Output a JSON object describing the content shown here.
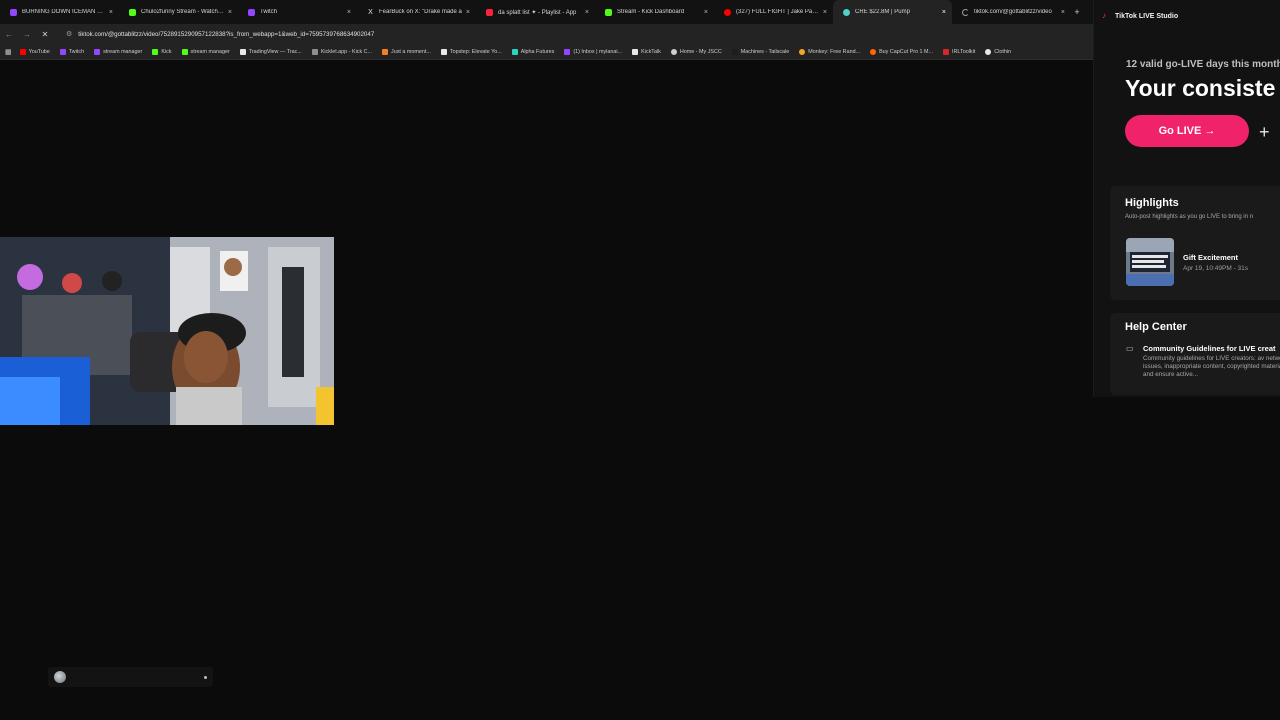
{
  "browser": {
    "tabs": [
      {
        "title": "BURNING DOWN ICEMAN FIN",
        "favicon_color": "#9147ff"
      },
      {
        "title": "Chulo2funny Stream - Watch Li",
        "favicon_color": "#53fc18"
      },
      {
        "title": "Twitch",
        "favicon_color": "#9147ff"
      },
      {
        "title": "FearBuck on X: \"Drake made a",
        "favicon_color": "#e7e7e7"
      },
      {
        "title": "da splatt list ✦ - Playlist - App",
        "favicon_color": "#fa243c"
      },
      {
        "title": "Stream - Kick Dashboard",
        "favicon_color": "#53fc18"
      },
      {
        "title": "(327) FULL FIGHT | Jake Paul vs",
        "favicon_color": "#ff0000"
      },
      {
        "title": "CRE $22.8M | Pump",
        "favicon_color": "#4fd1c5",
        "active": true
      },
      {
        "title": "tiktok.com/@gottablitzz/video",
        "favicon_color": "#9e9e9e"
      }
    ],
    "tab_close_glyph": "×",
    "new_tab_glyph": "+",
    "url": "tiktok.com/@gottablitzz/video/7528915290957122838?is_from_webapp=1&web_id=7595739768634902047",
    "bookmarks": [
      {
        "label": "YouTube",
        "color": "#ff0000"
      },
      {
        "label": "Twitch",
        "color": "#9147ff"
      },
      {
        "label": "stream manager",
        "color": "#9147ff"
      },
      {
        "label": "Kick",
        "color": "#53fc18"
      },
      {
        "label": "stream manager",
        "color": "#53fc18"
      },
      {
        "label": "TradingView — Trac...",
        "color": "#e8e8e8"
      },
      {
        "label": "Kicklet.app - Kick C...",
        "color": "#8f8f8f"
      },
      {
        "label": "Just a moment...",
        "color": "#f38020"
      },
      {
        "label": "Topstep: Elevate Yo...",
        "color": "#e8e8e8"
      },
      {
        "label": "Alpha Futures",
        "color": "#2dd4bf"
      },
      {
        "label": "(1) Inbox | mylanai...",
        "color": "#9147ff"
      },
      {
        "label": "KickTalk",
        "color": "#e8e8e8"
      },
      {
        "label": "Home - My JSCC",
        "color": "#cfcfcf"
      },
      {
        "label": "Machines - Tailscale",
        "color": "#1d1d1d"
      },
      {
        "label": "Monkey: Free Rand...",
        "color": "#f5a623"
      },
      {
        "label": "Buy CapCut Pro 1 M...",
        "color": "#ff6a00"
      },
      {
        "label": "IRLToolkit",
        "color": "#d4262b"
      },
      {
        "label": "Clothin",
        "color": "#e8e8e8"
      }
    ]
  },
  "studio": {
    "app_name": "TikTok LIVE Studio",
    "streak_text": "12 valid go-LIVE days this month",
    "headline": "Your consiste",
    "go_live_label": "Go LIVE →",
    "add_glyph": "+",
    "highlights": {
      "title": "Highlights",
      "subtitle": "Auto-post highlights as you go LIVE to bring in n",
      "item": {
        "title": "Gift Excitement",
        "meta": "Apr 19, 10:49PM - 31s"
      }
    },
    "help_center": {
      "title": "Help Center",
      "link": "Community Guidelines for LIVE creat",
      "description": "Community guidelines for LIVE creators: av network issues, inappropriate content, copyrighted material, and ensure active..."
    }
  },
  "colors": {
    "go_live": "#f0226a",
    "tiktok_accent": "#ff2a6d"
  }
}
